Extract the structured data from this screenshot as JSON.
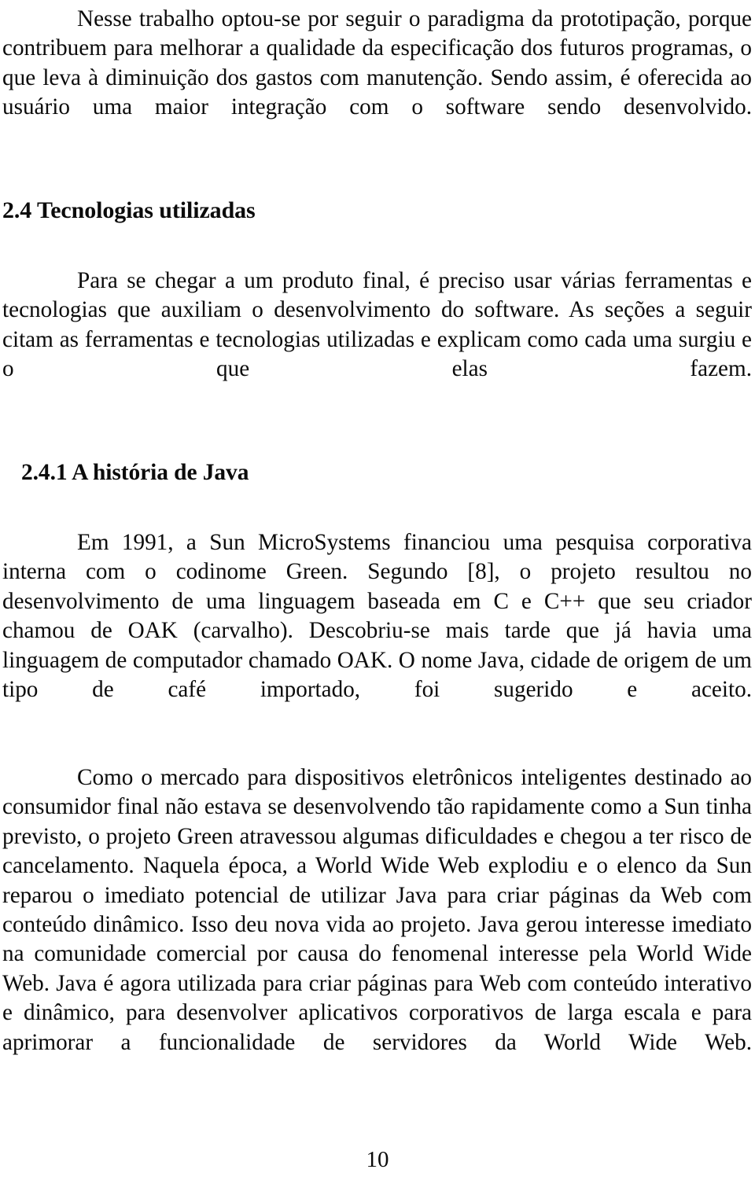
{
  "document": {
    "page_number": "10",
    "text_color": "#0b0b0b",
    "background_color": "#ffffff"
  },
  "body": {
    "paragraph_1": "Nesse trabalho optou-se por seguir o paradigma da prototipação, porque contribuem para melhorar a qualidade da especificação dos futuros programas, o que leva à diminuição dos gastos com manutenção. Sendo assim, é oferecida ao usuário uma maior integração com o software sendo desenvolvido.",
    "heading_2_4": "2.4 Tecnologias utilizadas",
    "paragraph_2": "Para se chegar a um produto final, é preciso usar várias ferramentas e tecnologias que auxiliam o desenvolvimento do software. As seções a seguir citam as ferramentas e tecnologias utilizadas e explicam como cada uma surgiu e o que elas fazem.",
    "heading_2_4_1": "2.4.1 A história de Java",
    "paragraph_3": "Em 1991, a Sun MicroSystems financiou uma pesquisa corporativa interna com o codinome Green. Segundo [8], o projeto resultou no desenvolvimento de uma linguagem baseada em C e C++ que seu criador chamou de OAK (carvalho). Descobriu-se mais tarde que já havia uma linguagem de computador chamado OAK. O nome Java, cidade de origem de um tipo de café importado, foi sugerido e aceito.",
    "paragraph_4": "Como o mercado para dispositivos eletrônicos inteligentes destinado ao consumidor final não estava se desenvolvendo tão rapidamente como a Sun tinha previsto,  o projeto Green atravessou algumas dificuldades e chegou a ter risco de cancelamento. Naquela época, a World Wide Web explodiu e o elenco da Sun reparou o imediato potencial de utilizar Java para criar páginas da Web com conteúdo dinâmico. Isso deu nova vida ao projeto. Java gerou interesse imediato na comunidade comercial por causa do fenomenal interesse pela World Wide Web. Java é agora utilizada para criar páginas para Web com conteúdo interativo e dinâmico, para desenvolver aplicativos corporativos de larga escala e para aprimorar a funcionalidade de servidores da World Wide Web."
  }
}
